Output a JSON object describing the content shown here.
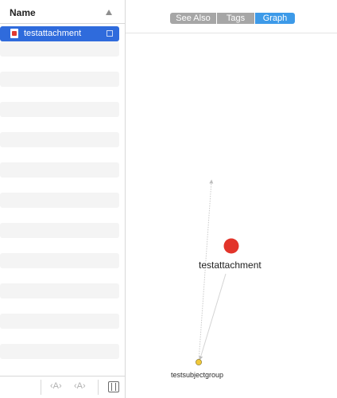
{
  "list": {
    "header_title": "Name",
    "selected_item": "testattachment",
    "stripe_rows": 11
  },
  "tabs": [
    {
      "label": "See Also",
      "active": false
    },
    {
      "label": "Tags",
      "active": false
    },
    {
      "label": "Graph",
      "active": true
    }
  ],
  "bottom_bar": {
    "decrease_font": "A",
    "increase_font": "A"
  },
  "graph": {
    "main_node_label": "testattachment",
    "secondary_node_label": "testsubjectgroup",
    "colors": {
      "main_node": "#e2342a",
      "secondary_node": "#f0c83a",
      "edge": "#c9c9c9",
      "active_tab": "#3d9ae8",
      "selection": "#2f6bdc"
    }
  }
}
